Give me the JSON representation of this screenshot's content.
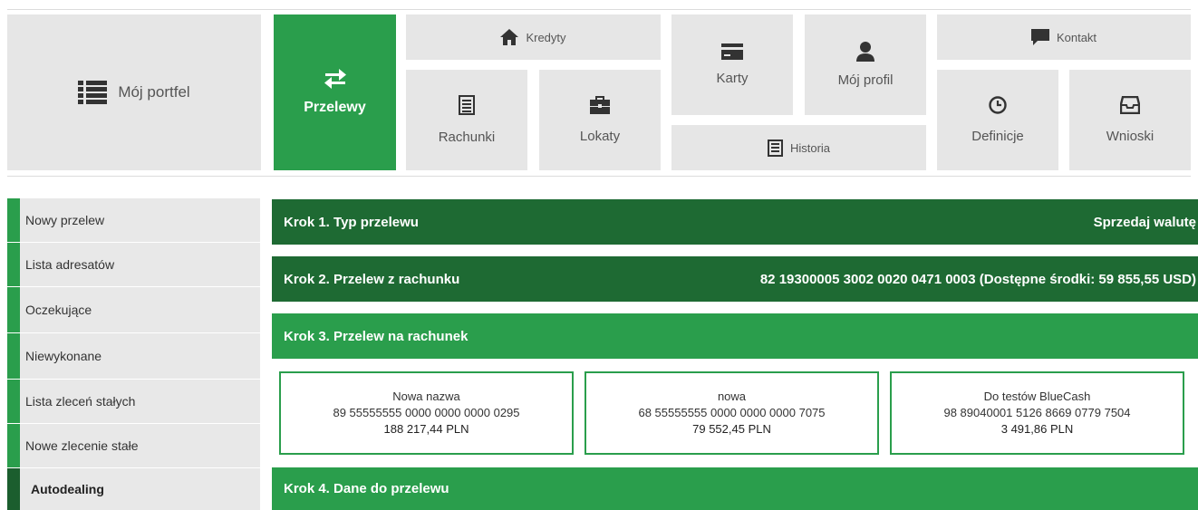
{
  "nav": {
    "portfel": "Mój portfel",
    "przelewy": "Przelewy",
    "kredyty": "Kredyty",
    "rachunki": "Rachunki",
    "lokaty": "Lokaty",
    "karty": "Karty",
    "profil": "Mój profil",
    "historia": "Historia",
    "kontakt": "Kontakt",
    "definicje": "Definicje",
    "wnioski": "Wnioski"
  },
  "sidebar": {
    "items": [
      {
        "label": "Nowy przelew"
      },
      {
        "label": "Lista adresatów"
      },
      {
        "label": "Oczekujące"
      },
      {
        "label": "Niewykonane"
      },
      {
        "label": "Lista zleceń stałych"
      },
      {
        "label": "Nowe zlecenie stałe"
      },
      {
        "label": "Autodealing"
      }
    ]
  },
  "steps": {
    "step1": {
      "label": "Krok 1. Typ przelewu",
      "value": "Sprzedaj walutę"
    },
    "step2": {
      "label": "Krok 2. Przelew z rachunku",
      "value": "82 19300005 3002 0020 0471 0003 (Dostępne środki: 59 855,55 USD)"
    },
    "step3": {
      "label": "Krok 3. Przelew na rachunek"
    },
    "step4": {
      "label": "Krok 4. Dane do przelewu"
    }
  },
  "accounts": [
    {
      "name": "Nowa nazwa",
      "number": "89 55555555 0000 0000 0000 0295",
      "balance": "188 217,44 PLN"
    },
    {
      "name": "nowa",
      "number": "68 55555555 0000 0000 0000 7075",
      "balance": "79 552,45 PLN"
    },
    {
      "name": "Do testów BlueCash",
      "number": "98 89040001 5126 8669 0779 7504",
      "balance": "3 491,86 PLN"
    }
  ],
  "colors": {
    "accent": "#2a9e4c",
    "accent_dark": "#1e6a33",
    "tile": "#e6e6e6"
  }
}
